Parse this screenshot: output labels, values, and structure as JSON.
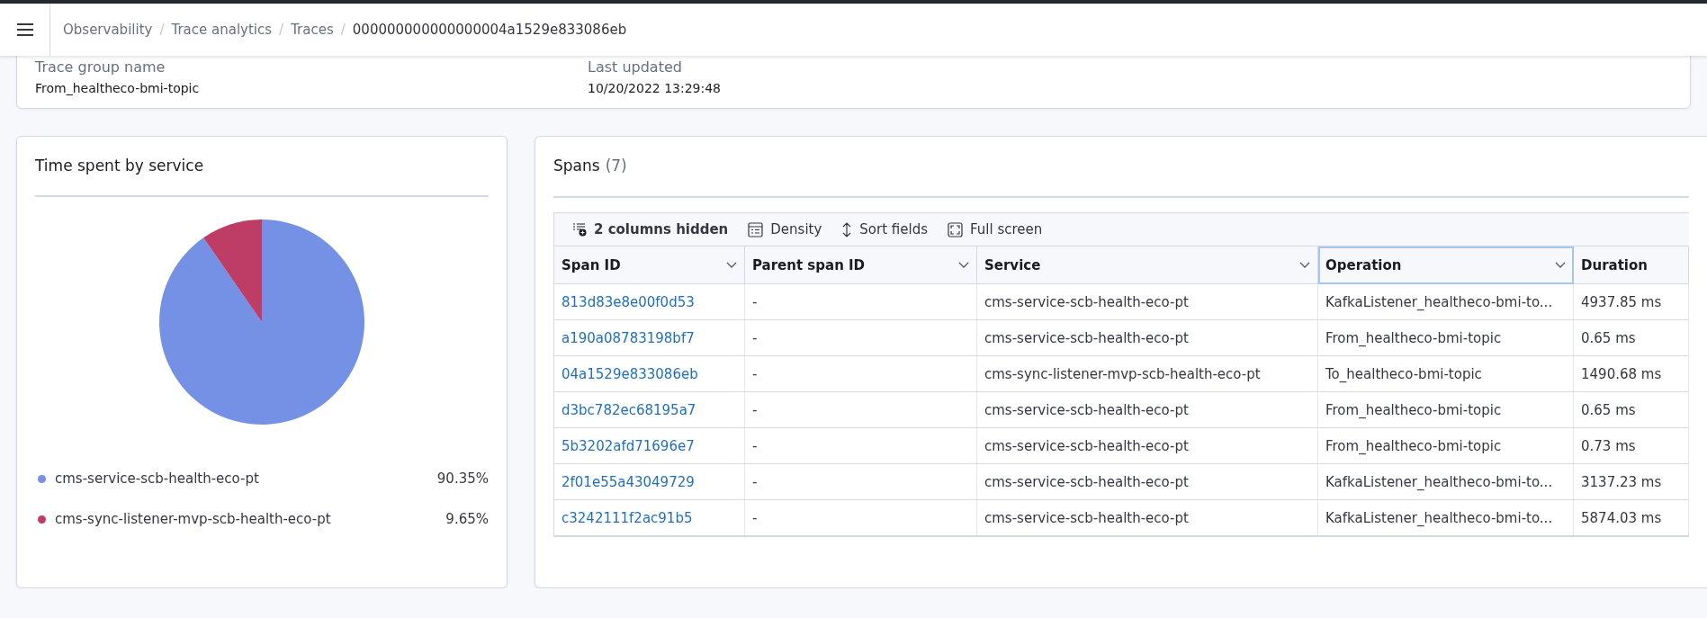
{
  "header": {
    "separator": "/",
    "breadcrumbs": [
      "Observability",
      "Trace analytics",
      "Traces",
      "000000000000000004a1529e833086eb"
    ]
  },
  "summary": {
    "fields": [
      {
        "label": "Trace group name",
        "value": "From_healtheco-bmi-topic"
      },
      {
        "label": "Last updated",
        "value": "10/20/2022 13:29:48"
      }
    ]
  },
  "service_panel": {
    "title": "Time spent by service",
    "chart_data": {
      "type": "pie",
      "categories": [
        "cms-service-scb-health-eco-pt",
        "cms-sync-listener-mvp-scb-health-eco-pt"
      ],
      "values": [
        90.35,
        9.65
      ]
    },
    "legend": [
      {
        "value": "90.35%",
        "color": "#7491e5"
      },
      {
        "value": "9.65%",
        "color": "#be3d66"
      }
    ]
  },
  "spans_panel": {
    "title": "Spans",
    "count": "(7)",
    "toolbar": [
      {
        "kind": "columns",
        "label": "2 columns hidden"
      },
      {
        "kind": "density",
        "label": "Density"
      },
      {
        "kind": "sort",
        "label": "Sort fields"
      },
      {
        "kind": "fullscreen",
        "label": "Full screen"
      }
    ],
    "columns": [
      {
        "label": "Span ID",
        "selected": false,
        "menu": true
      },
      {
        "label": "Parent span ID",
        "selected": false,
        "menu": true
      },
      {
        "label": "Service",
        "selected": false,
        "menu": true
      },
      {
        "label": "Operation",
        "selected": true,
        "menu": true
      },
      {
        "label": "Duration",
        "selected": false,
        "menu": false
      }
    ],
    "rows": [
      [
        "813d83e8e00f0d53",
        "-",
        "cms-service-scb-health-eco-pt",
        "KafkaListener_healtheco-bmi-to...",
        "4937.85 ms"
      ],
      [
        "a190a08783198bf7",
        "-",
        "cms-service-scb-health-eco-pt",
        "From_healtheco-bmi-topic",
        "0.65 ms"
      ],
      [
        "04a1529e833086eb",
        "-",
        "cms-sync-listener-mvp-scb-health-eco-pt",
        "To_healtheco-bmi-topic",
        "1490.68 ms"
      ],
      [
        "d3bc782ec68195a7",
        "-",
        "cms-service-scb-health-eco-pt",
        "From_healtheco-bmi-topic",
        "0.65 ms"
      ],
      [
        "5b3202afd71696e7",
        "-",
        "cms-service-scb-health-eco-pt",
        "From_healtheco-bmi-topic",
        "0.73 ms"
      ],
      [
        "2f01e55a43049729",
        "-",
        "cms-service-scb-health-eco-pt",
        "KafkaListener_healtheco-bmi-to...",
        "3137.23 ms"
      ],
      [
        "c3242111f2ac91b5",
        "-",
        "cms-service-scb-health-eco-pt",
        "KafkaListener_healtheco-bmi-to...",
        "5874.03 ms"
      ]
    ]
  }
}
